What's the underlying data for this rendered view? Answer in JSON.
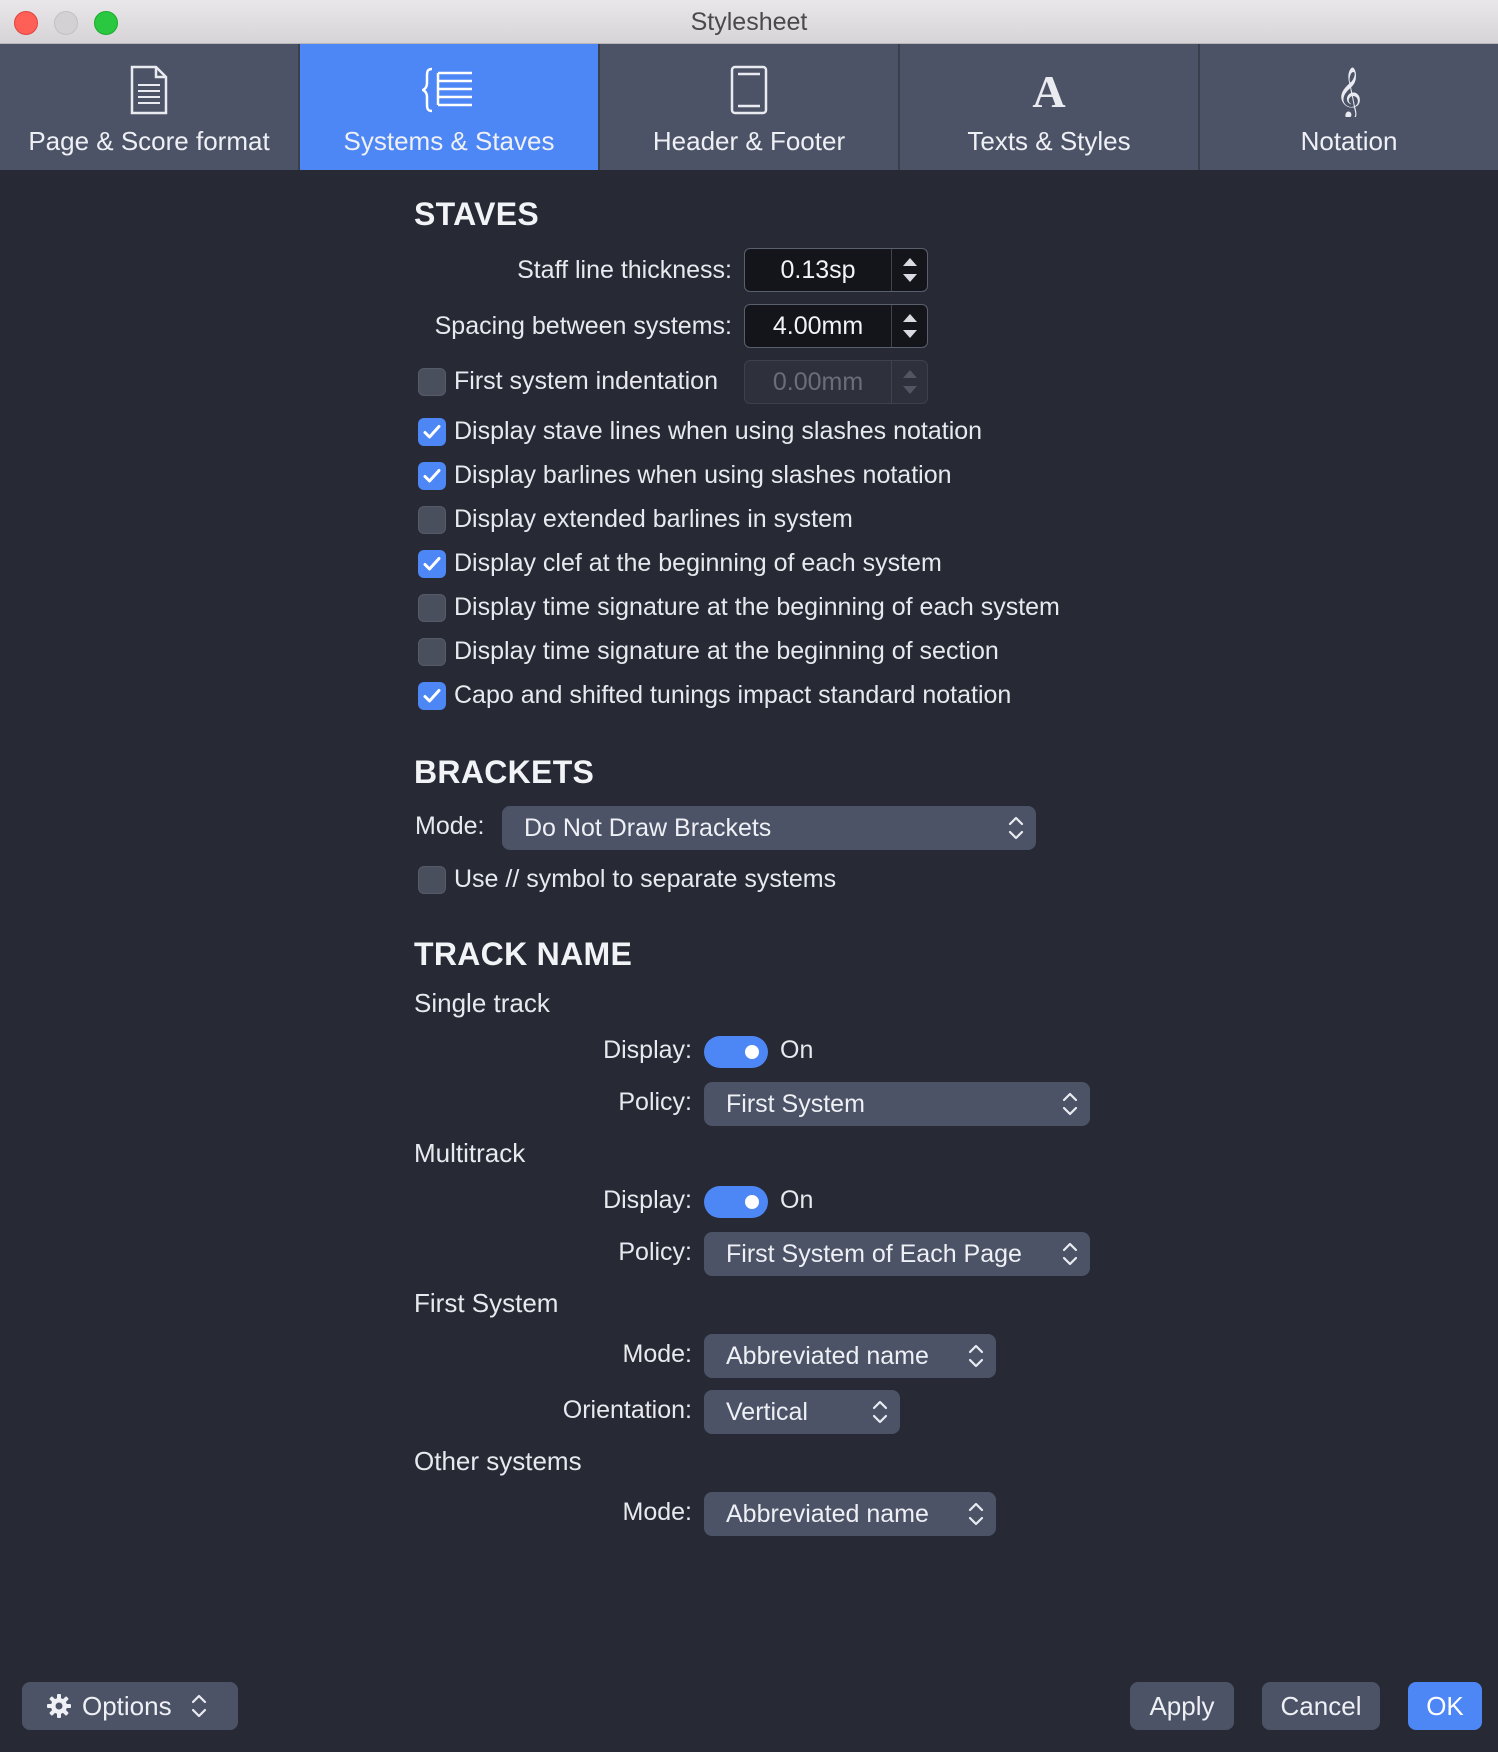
{
  "window": {
    "title": "Stylesheet"
  },
  "tabs": [
    {
      "label": "Page & Score format",
      "icon": "page-icon",
      "active": false
    },
    {
      "label": "Systems & Staves",
      "icon": "systems-staves-icon",
      "active": true
    },
    {
      "label": "Header & Footer",
      "icon": "header-footer-icon",
      "active": false
    },
    {
      "label": "Texts & Styles",
      "icon": "text-style-icon",
      "active": false
    },
    {
      "label": "Notation",
      "icon": "treble-clef-icon",
      "active": false
    }
  ],
  "staves": {
    "title": "STAVES",
    "staff_line_thickness": {
      "label": "Staff line thickness:",
      "value": "0.13sp"
    },
    "spacing_between_systems": {
      "label": "Spacing between systems:",
      "value": "4.00mm"
    },
    "first_system_indentation": {
      "label": "First system indentation",
      "value": "0.00mm",
      "checked": false
    },
    "options": [
      {
        "label": "Display stave lines when using slashes notation",
        "checked": true
      },
      {
        "label": "Display barlines when using slashes notation",
        "checked": true
      },
      {
        "label": "Display extended barlines in system",
        "checked": false
      },
      {
        "label": "Display clef at the beginning of each system",
        "checked": true
      },
      {
        "label": "Display time signature at the beginning of each system",
        "checked": false
      },
      {
        "label": "Display time signature at the beginning of section",
        "checked": false
      },
      {
        "label": "Capo and shifted tunings impact standard notation",
        "checked": true
      }
    ]
  },
  "brackets": {
    "title": "BRACKETS",
    "mode_label": "Mode:",
    "mode_value": "Do Not Draw Brackets",
    "separator_option": {
      "label": "Use // symbol to separate systems",
      "checked": false
    }
  },
  "track_name": {
    "title": "TRACK NAME",
    "single_track": {
      "title": "Single track",
      "display_label": "Display:",
      "display_value": "On",
      "policy_label": "Policy:",
      "policy_value": "First System"
    },
    "multitrack": {
      "title": "Multitrack",
      "display_label": "Display:",
      "display_value": "On",
      "policy_label": "Policy:",
      "policy_value": "First System of Each Page"
    },
    "first_system": {
      "title": "First System",
      "mode_label": "Mode:",
      "mode_value": "Abbreviated name",
      "orientation_label": "Orientation:",
      "orientation_value": "Vertical"
    },
    "other_systems": {
      "title": "Other systems",
      "mode_label": "Mode:",
      "mode_value": "Abbreviated name"
    }
  },
  "footer": {
    "options_label": "Options",
    "apply_label": "Apply",
    "cancel_label": "Cancel",
    "ok_label": "OK"
  },
  "colors": {
    "background": "#272a35",
    "accent": "#4d86f5",
    "control": "#4c5366"
  }
}
